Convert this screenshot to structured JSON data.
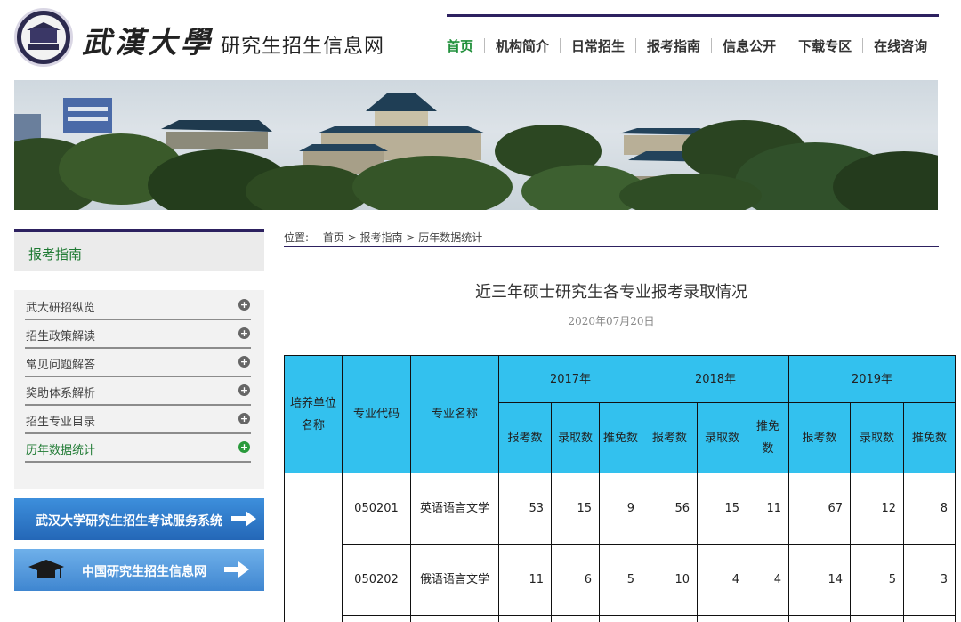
{
  "header": {
    "university_name": "武漢大學",
    "site_name": "研究生招生信息网",
    "nav": [
      {
        "label": "首页",
        "active": true
      },
      {
        "label": "机构简介",
        "active": false
      },
      {
        "label": "日常招生",
        "active": false
      },
      {
        "label": "报考指南",
        "active": false
      },
      {
        "label": "信息公开",
        "active": false
      },
      {
        "label": "下载专区",
        "active": false
      },
      {
        "label": "在线咨询",
        "active": false
      }
    ]
  },
  "sidebar": {
    "heading": "报考指南",
    "items": [
      {
        "label": "武大研招纵览",
        "active": false
      },
      {
        "label": "招生政策解读",
        "active": false
      },
      {
        "label": "常见问题解答",
        "active": false
      },
      {
        "label": "奖助体系解析",
        "active": false
      },
      {
        "label": "招生专业目录",
        "active": false
      },
      {
        "label": "历年数据统计",
        "active": true
      }
    ],
    "promo_exam_system": "武汉大学研究生招生考试服务系统",
    "promo_chsi": "中国研究生招生信息网"
  },
  "breadcrumb": {
    "label": "位置:",
    "path": "首页 > 报考指南 > 历年数据统计"
  },
  "article": {
    "title": "近三年硕士研究生各专业报考录取情况",
    "date": "2020年07月20日"
  },
  "table": {
    "col_unit": "培养单位名称",
    "col_code": "专业代码",
    "col_name": "专业名称",
    "years": [
      "2017年",
      "2018年",
      "2019年"
    ],
    "sub_headers": [
      [
        "报考数",
        "录取数",
        "推免数"
      ],
      [
        "报考数",
        "录取数",
        "推免数"
      ],
      [
        "报考数",
        "录取数",
        "推免数"
      ]
    ],
    "rows": [
      {
        "code": "050201",
        "name": "英语语言文学",
        "values": [
          "53",
          "15",
          "9",
          "56",
          "15",
          "11",
          "67",
          "12",
          "8"
        ]
      },
      {
        "code": "050202",
        "name": "俄语语言文学",
        "values": [
          "11",
          "6",
          "5",
          "10",
          "4",
          "4",
          "14",
          "5",
          "3"
        ]
      }
    ]
  },
  "colors": {
    "brand_purple": "#2d2160",
    "accent_green": "#1f8f3a",
    "table_header_cyan": "#33c1ee"
  }
}
